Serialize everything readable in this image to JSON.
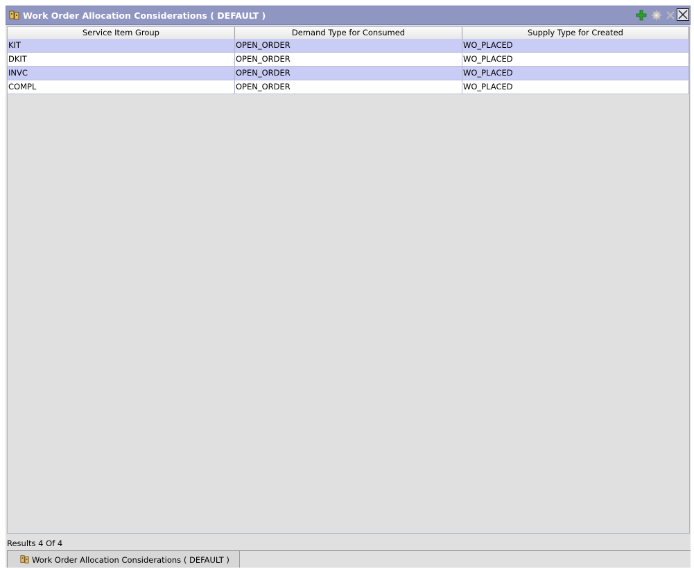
{
  "window": {
    "title": "Work Order Allocation Considerations ( DEFAULT )",
    "title_icon": "allocation-icon",
    "toolbar": [
      {
        "name": "add-icon",
        "color": "#2e9e2e",
        "enabled": true
      },
      {
        "name": "gear-icon",
        "color": "#c8c8c8",
        "enabled": false
      },
      {
        "name": "delete-icon",
        "color": "#b8b8b8",
        "enabled": false
      },
      {
        "name": "close-icon",
        "color": "#1c1c1c",
        "enabled": true
      }
    ]
  },
  "table": {
    "columns": [
      "Service Item Group",
      "Demand Type for Consumed",
      "Supply Type for Created"
    ],
    "rows": [
      {
        "group": "KIT",
        "demand": "OPEN_ORDER",
        "supply": "WO_PLACED",
        "selected": true
      },
      {
        "group": "DKIT",
        "demand": "OPEN_ORDER",
        "supply": "WO_PLACED",
        "selected": false
      },
      {
        "group": "INVC",
        "demand": "OPEN_ORDER",
        "supply": "WO_PLACED",
        "selected": true
      },
      {
        "group": "COMPL",
        "demand": "OPEN_ORDER",
        "supply": "WO_PLACED",
        "selected": false
      }
    ]
  },
  "status": {
    "results": "Results 4 Of 4"
  },
  "bottom_tab": {
    "label": "Work Order Allocation Considerations ( DEFAULT )"
  },
  "colors": {
    "titlebar": "#9096c2",
    "selected_row": "#c9ccf5",
    "background": "#e0e0e0"
  }
}
